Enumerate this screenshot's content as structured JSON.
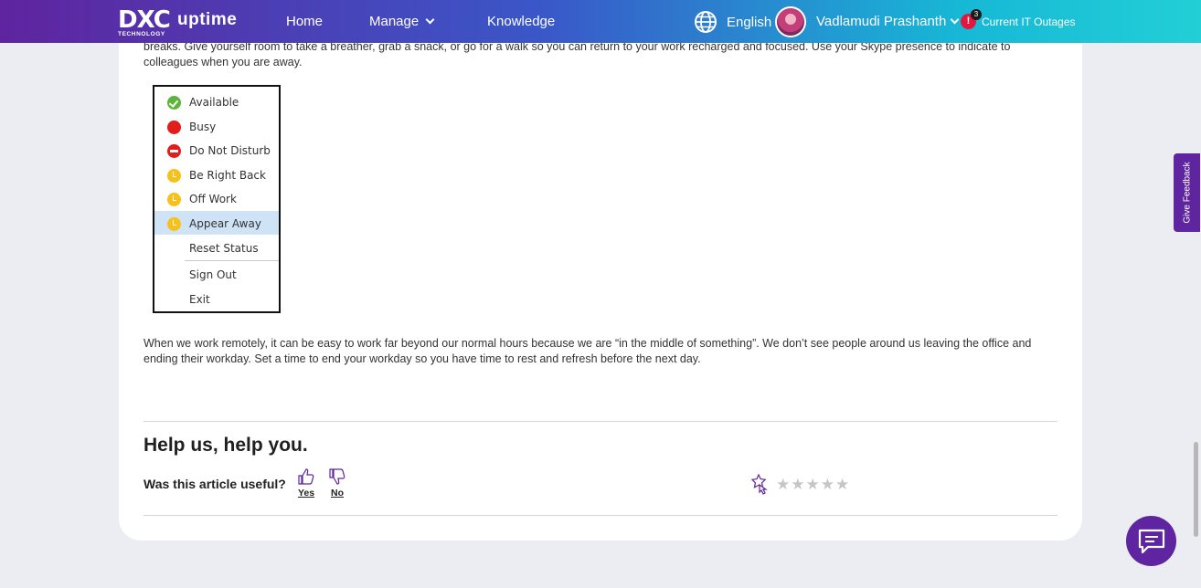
{
  "header": {
    "logo_mark": "DXC",
    "logo_sub": "TECHNOLOGY",
    "product": "uptime",
    "nav": [
      {
        "label": "Home"
      },
      {
        "label": "Manage"
      },
      {
        "label": "Knowledge"
      }
    ],
    "language": "English",
    "user_name": "Vadlamudi Prashanth",
    "outage_badge_icon": "!",
    "outage_count": "3",
    "outages_label": "Current IT Outages"
  },
  "article": {
    "paragraph_1": "breaks. Give yourself room to take a breather, grab a snack, or go for a walk so you can return to your work recharged and focused. Use your Skype presence to indicate to colleagues when you are away.",
    "presence_menu": [
      {
        "label": "Available",
        "status": "available"
      },
      {
        "label": "Busy",
        "status": "busy"
      },
      {
        "label": "Do Not Disturb",
        "status": "dnd"
      },
      {
        "label": "Be Right Back",
        "status": "away"
      },
      {
        "label": "Off Work",
        "status": "away"
      },
      {
        "label": "Appear Away",
        "status": "away",
        "selected": true
      },
      {
        "label": "Reset Status",
        "status": "none"
      },
      {
        "label": "Sign Out",
        "status": "none"
      },
      {
        "label": "Exit",
        "status": "none"
      }
    ],
    "paragraph_2": "When we work remotely, it can be easy to work far beyond our normal hours because we are “in the middle of something”. We don’t see people around us leaving the office and ending their workday. Set a time to end your workday so you have time to rest and refresh before the next day."
  },
  "feedback": {
    "title": "Help us, help you.",
    "question": "Was this article useful?",
    "yes_label": "Yes",
    "no_label": "No",
    "rating": 0,
    "stars": [
      "★",
      "★",
      "★",
      "★",
      "★"
    ]
  },
  "side": {
    "feedback_tab": "Give Feedback"
  },
  "colors": {
    "brand_purple": "#5f249f",
    "header_gradient_end": "#22cfd6",
    "alert_red": "#e3173e"
  }
}
